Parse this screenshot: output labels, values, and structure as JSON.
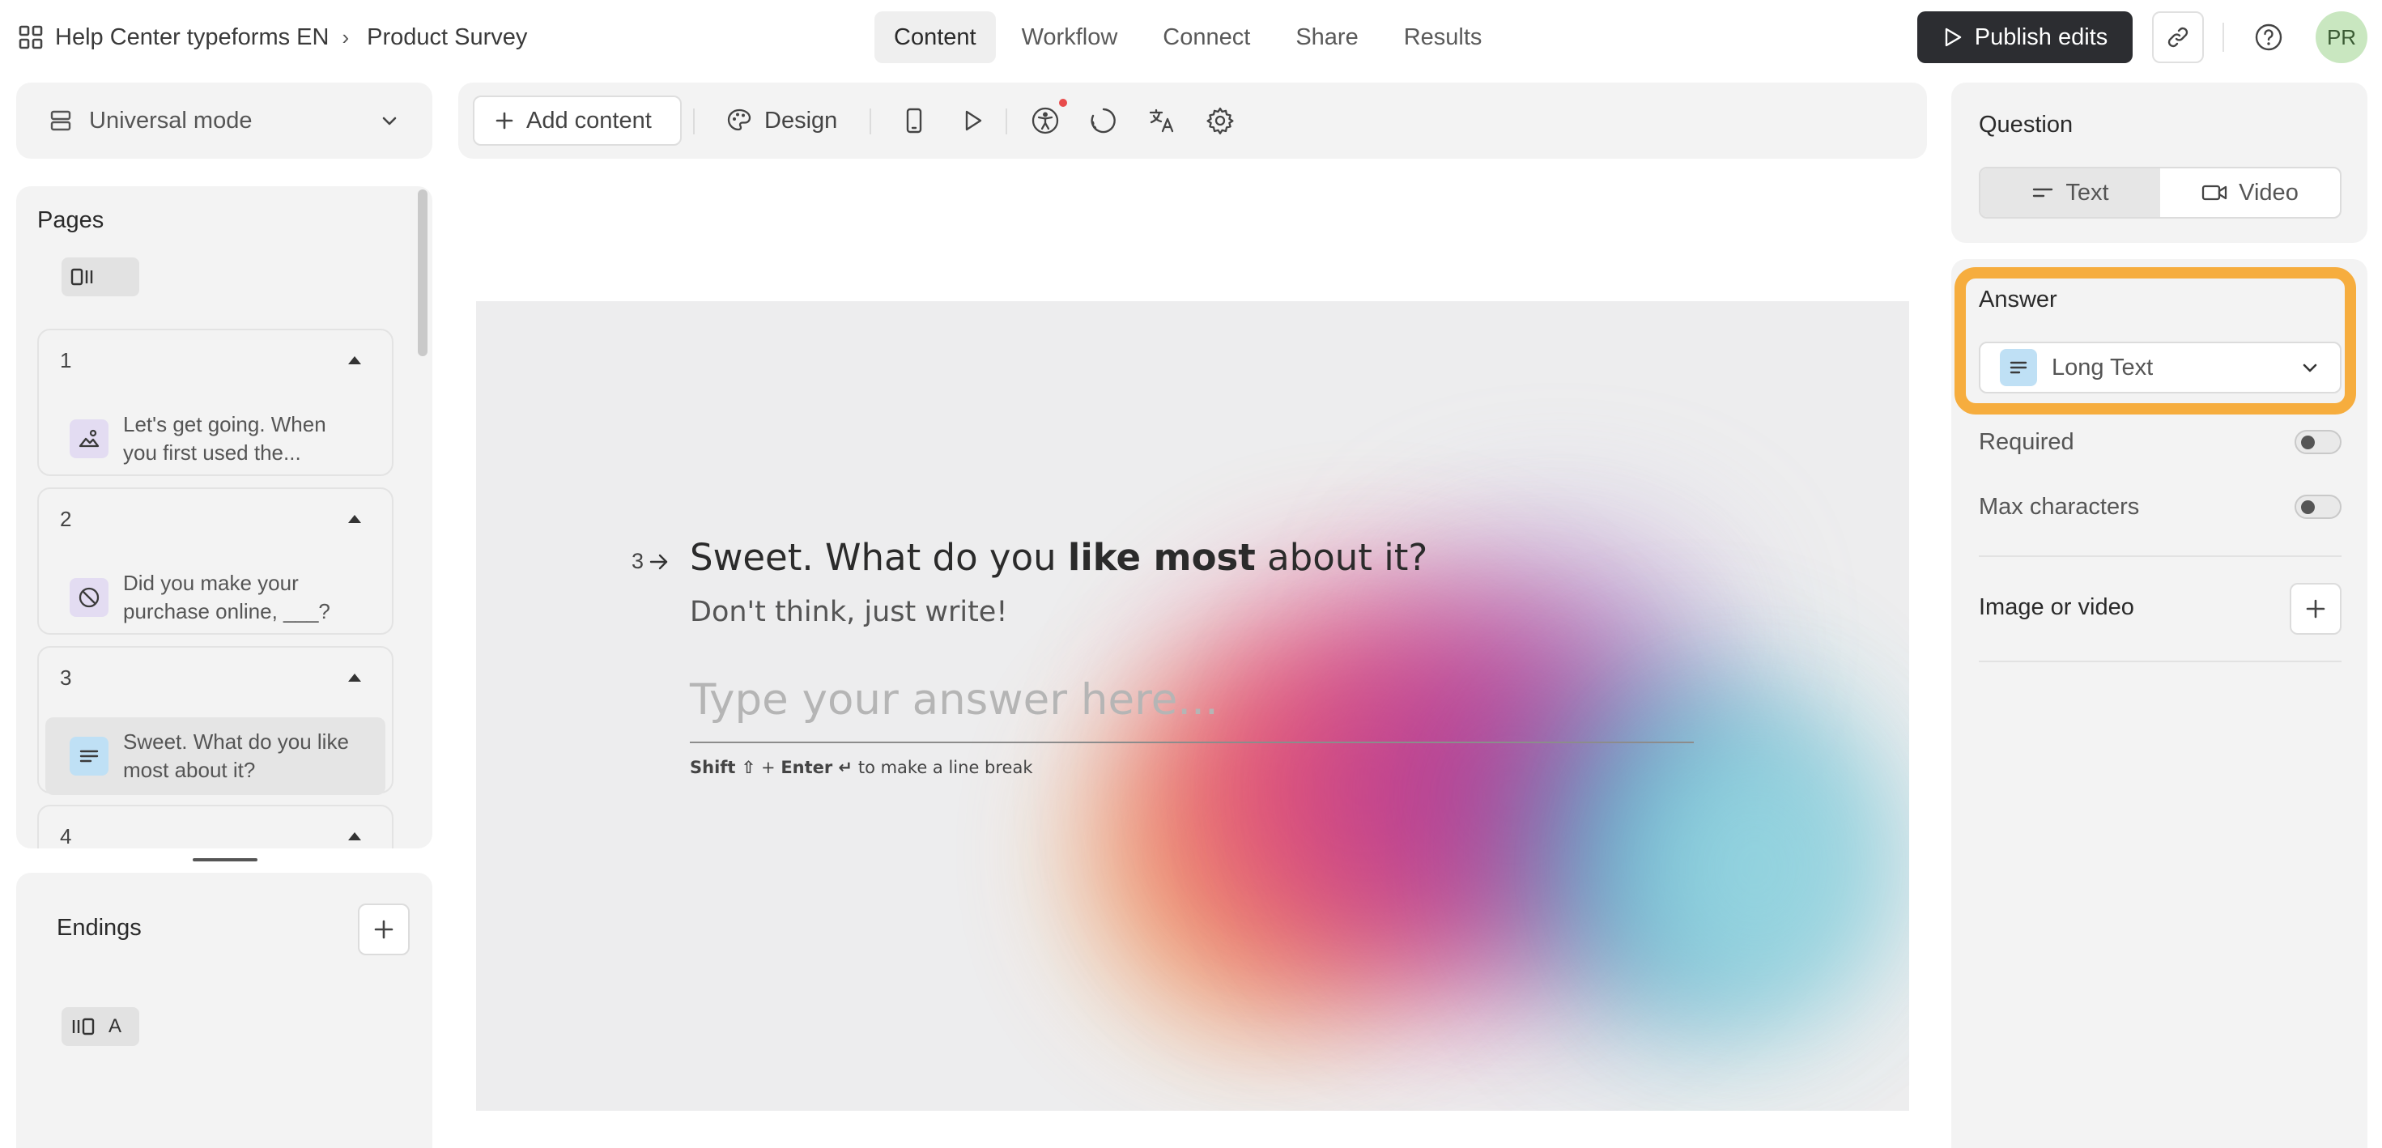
{
  "header": {
    "workspace": "Help Center typeforms EN",
    "breadcrumb_separator": "›",
    "form_title": "Product Survey",
    "tabs": [
      {
        "label": "Content",
        "active": true
      },
      {
        "label": "Workflow",
        "active": false
      },
      {
        "label": "Connect",
        "active": false
      },
      {
        "label": "Share",
        "active": false
      },
      {
        "label": "Results",
        "active": false
      }
    ],
    "publish_label": "Publish edits",
    "avatar_initials": "PR",
    "icons": [
      "grid-icon",
      "play-icon",
      "link-icon",
      "help-icon"
    ]
  },
  "sidebar": {
    "mode_label": "Universal mode",
    "pages_title": "Pages",
    "pages": [
      {
        "number": "1",
        "text": "Let's get going. When you first used the...",
        "icon": "image-icon",
        "icon_bg": "#e3dcf2",
        "selected": false
      },
      {
        "number": "2",
        "text": "Did you make your purchase online, ___?",
        "icon": "no-entry-icon",
        "icon_bg": "#e3dcf2",
        "selected": false
      },
      {
        "number": "3",
        "text": "Sweet. What do you like most about it?",
        "icon": "long-text-icon",
        "icon_bg": "#bfe0f5",
        "selected": true
      },
      {
        "number": "4",
        "text": "",
        "icon": "",
        "icon_bg": "",
        "selected": false
      }
    ],
    "endings_title": "Endings",
    "endings_toggle_label": "A"
  },
  "toolbar": {
    "add_content_label": "Add content",
    "design_label": "Design",
    "icons": [
      "mobile-preview-icon",
      "play-icon",
      "accessibility-icon",
      "loading-icon",
      "translate-icon",
      "settings-icon"
    ]
  },
  "preview": {
    "question_number": "3",
    "title_pre": "Sweet. What do you ",
    "title_bold": "like most",
    "title_post": " about it?",
    "subtitle": "Don't think, just write!",
    "answer_placeholder": "Type your answer here...",
    "hint_shift": "Shift ⇧",
    "hint_plus": " + ",
    "hint_enter": "Enter ↵",
    "hint_rest": " to make a line break"
  },
  "right_panel": {
    "question_label": "Question",
    "question_options": [
      {
        "label": "Text",
        "active": true
      },
      {
        "label": "Video",
        "active": false
      }
    ],
    "answer_label": "Answer",
    "answer_type": "Long Text",
    "required_label": "Required",
    "required_on": false,
    "max_chars_label": "Max characters",
    "max_chars_on": false,
    "image_label": "Image or video",
    "highlight_color": "#f6ad3e"
  },
  "colors": {
    "accent_dark": "#2c2d31",
    "notification": "#e84b4b",
    "avatar_bg": "#c9e7c0"
  }
}
